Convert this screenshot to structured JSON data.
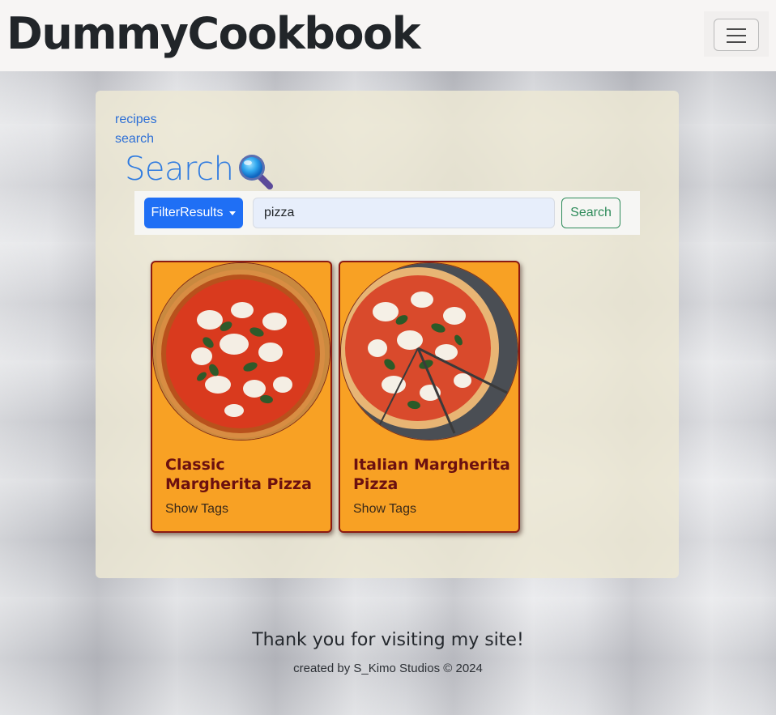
{
  "navbar": {
    "brand": "DummyCookbook",
    "toggler_icon": "hamburger-menu-icon"
  },
  "nav_links": {
    "recipes": "recipes",
    "search": "search"
  },
  "page": {
    "title": "Search",
    "title_icon": "magnifying-glass-icon"
  },
  "search_bar": {
    "filter_label": "FilterResults",
    "query_value": "pizza",
    "search_label": "Search"
  },
  "results": [
    {
      "title": "Classic Margherita Pizza",
      "tags_label": "Show Tags"
    },
    {
      "title": "Italian Margherita Pizza",
      "tags_label": "Show Tags"
    }
  ],
  "footer": {
    "thanks": "Thank you for visiting my site!",
    "credit": "created by S_Kimo Studios © 2024"
  },
  "colors": {
    "primary": "#1f6ff5",
    "success": "#2e8b5a",
    "card_bg": "#f8a124",
    "card_border": "#8b1a12",
    "card_title": "#6b1010",
    "link": "#2d6fd6"
  }
}
